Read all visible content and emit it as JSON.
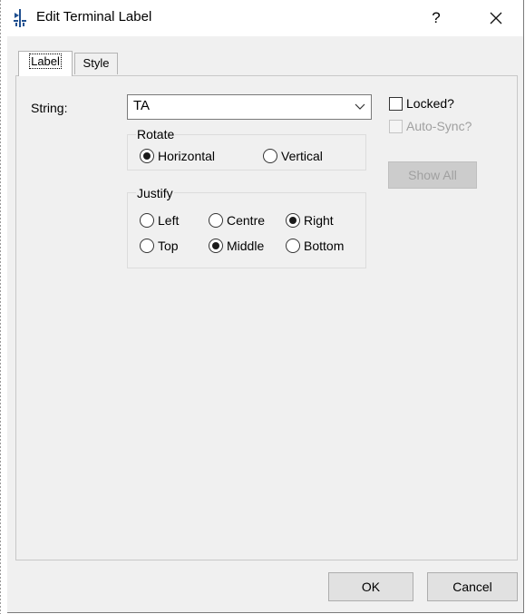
{
  "window": {
    "title": "Edit Terminal Label",
    "help_label": "?"
  },
  "tabs": [
    {
      "label": "Label",
      "active": true
    },
    {
      "label": "Style",
      "active": false
    }
  ],
  "string_field": {
    "label": "String:",
    "value": "TA"
  },
  "locked": {
    "label": "Locked?",
    "checked": false
  },
  "auto_sync": {
    "label": "Auto-Sync?",
    "checked": false,
    "enabled": false
  },
  "show_all": {
    "label": "Show All",
    "enabled": false
  },
  "rotate": {
    "title": "Rotate",
    "options": [
      {
        "label": "Horizontal",
        "selected": true
      },
      {
        "label": "Vertical",
        "selected": false
      }
    ]
  },
  "justify": {
    "title": "Justify",
    "options": [
      {
        "label": "Left",
        "selected": false
      },
      {
        "label": "Centre",
        "selected": false
      },
      {
        "label": "Right",
        "selected": true
      },
      {
        "label": "Top",
        "selected": false
      },
      {
        "label": "Middle",
        "selected": true
      },
      {
        "label": "Bottom",
        "selected": false
      }
    ]
  },
  "buttons": {
    "ok": "OK",
    "cancel": "Cancel"
  }
}
